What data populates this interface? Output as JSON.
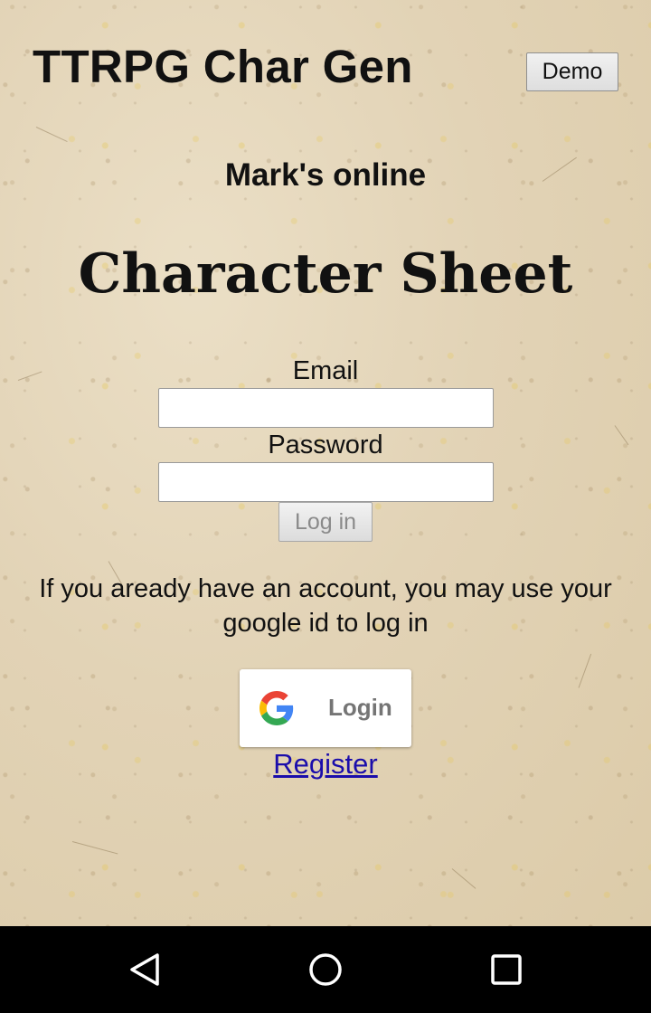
{
  "header": {
    "title": "TTRPG Char Gen",
    "demo_label": "Demo"
  },
  "status": {
    "online_text": "Mark's online"
  },
  "page": {
    "title": "Character Sheet"
  },
  "login_form": {
    "email_label": "Email",
    "email_value": "",
    "password_label": "Password",
    "password_value": "",
    "submit_label": "Log in"
  },
  "google": {
    "note": "If you aready have an account, you may use your google id to log in",
    "button_label": "Login",
    "icon": "google-g-icon"
  },
  "register": {
    "label": "Register"
  },
  "system_nav": {
    "back_icon": "back-triangle-icon",
    "home_icon": "home-circle-icon",
    "recents_icon": "recents-square-icon"
  },
  "colors": {
    "background": "#e4d7bd",
    "link": "#1a0dab",
    "google_blue": "#4285F4",
    "google_red": "#EA4335",
    "google_yellow": "#FBBC05",
    "google_green": "#34A853"
  }
}
